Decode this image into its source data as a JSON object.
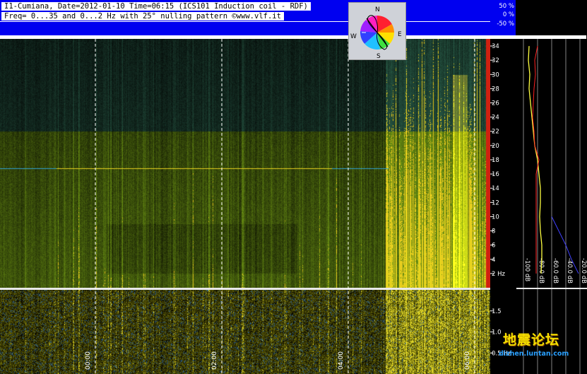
{
  "header": {
    "title": "I1-Cumiana, Date=2012-01-10 Time=06:15 (ICS101 Induction coil - RDF)",
    "subtitle": "Freq= 0...35 and 0...2 Hz with 25° nulling pattern ©www.vlf.it"
  },
  "percent_scale": [
    "50 %",
    "0 %",
    "-50 %"
  ],
  "compass": {
    "n": "N",
    "e": "E",
    "s": "S",
    "w": "W"
  },
  "watermark": {
    "cn": "地震论坛",
    "en": "dizhen.luntan.com"
  },
  "colors": {
    "header_bg": "#0000f0",
    "profile_red": "#ff2020",
    "profile_yellow": "#ffff40",
    "profile_blue": "#4040ff"
  },
  "chart_data": [
    {
      "type": "heatmap",
      "description_role": "spectrogram-main",
      "xlabel": "",
      "ylabel": "",
      "x_ticks": [
        "00:00",
        "02:00",
        "04:00",
        "06:00"
      ],
      "y_ticks": [
        "2 Hz",
        "4",
        "6",
        "8",
        "10",
        "12",
        "14",
        "16",
        "18",
        "20",
        "22",
        "24",
        "26",
        "28",
        "30",
        "32",
        "34"
      ],
      "ylim": [
        0,
        35
      ],
      "time_range": [
        "22:15",
        "06:15"
      ],
      "features": [
        {
          "kind": "horizontal-line",
          "freq": 16.8
        }
      ]
    },
    {
      "type": "heatmap",
      "description_role": "spectrogram-low",
      "y_ticks": [
        "0.5 Hz",
        "1.0",
        "1.5"
      ],
      "ylim": [
        0,
        2
      ]
    },
    {
      "type": "line",
      "description_role": "spectrum-profile",
      "x_ticks": [
        "-100 dB",
        "-80.0 dB",
        "-60.0 dB",
        "-40.0 dB",
        "-20.0 dB"
      ],
      "xlim": [
        -110,
        -10
      ],
      "series": [
        {
          "freq": [
            34,
            32,
            30,
            28,
            26,
            24,
            22,
            20,
            18,
            16,
            14,
            12,
            10,
            8,
            6,
            4,
            2
          ],
          "values": [
            -92,
            -93,
            -91,
            -92,
            -90,
            -88,
            -86,
            -84,
            -80,
            -78,
            -76,
            -76,
            -77,
            -76,
            -74,
            -74,
            -75
          ]
        },
        {
          "freq": [
            34,
            32,
            30,
            28,
            26,
            24,
            22,
            20,
            18,
            16,
            14,
            12,
            10,
            8,
            6,
            4,
            2
          ],
          "values": [
            -80,
            -84,
            -83,
            -85,
            -86,
            -87,
            -85,
            -84,
            -78,
            -82,
            -82,
            -82,
            -82,
            -82,
            -82,
            -82,
            -82
          ]
        },
        {
          "freq": [
            10,
            8,
            6,
            4,
            2
          ],
          "values": [
            -60,
            -50,
            -40,
            -32,
            -22
          ]
        }
      ]
    }
  ]
}
